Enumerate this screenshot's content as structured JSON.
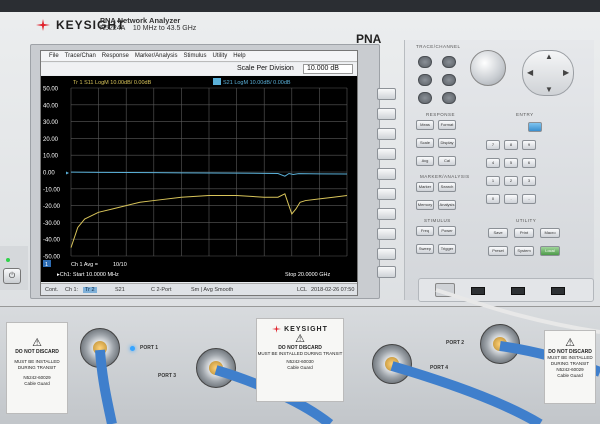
{
  "instrument": {
    "brand": "KEYSIGHT",
    "product_title": "PNA Network Analyzer",
    "model_number": "N5224A",
    "model_freq": "10 MHz to 43.5 GHz",
    "badge": "PNA"
  },
  "menu": [
    "File",
    "Trace/Chan",
    "Response",
    "Marker/Analysis",
    "Stimulus",
    "Utility",
    "Help"
  ],
  "scale": {
    "label": "Scale Per Division",
    "value": "10.000 dB"
  },
  "traces": {
    "tr1_label": "Tr 1  S11 LogM 10.00dB/  0.00dB",
    "tr2_label": "S21 LogM 10.00dB/  0.00dB",
    "y_ticks": [
      "50.00",
      "40.00",
      "30.00",
      "20.00",
      "10.00",
      "0.00",
      "-10.00",
      "-20.00",
      "-30.00",
      "-40.00",
      "-50.00"
    ],
    "ref_marker": "▸",
    "colors": {
      "s11": "#d8c45a",
      "s21": "#5ab0d8",
      "grid": "#5a5a5a",
      "axis_text": "#ffffff"
    }
  },
  "chart_data": {
    "type": "line",
    "x_unit": "GHz",
    "xlim": [
      0.01,
      20.0
    ],
    "ylim": [
      -50,
      50
    ],
    "ylabel": "",
    "xlabel": "",
    "series": [
      {
        "name": "S11",
        "x": [
          0.01,
          0.5,
          1,
          2,
          3,
          4,
          5,
          6,
          8,
          10,
          12,
          14,
          15,
          15.5,
          16,
          16.3,
          16.6,
          17,
          18,
          19,
          20
        ],
        "values": [
          -45,
          -33,
          -28,
          -24,
          -22,
          -20,
          -18,
          -17,
          -15,
          -14,
          -14,
          -15,
          -15,
          -13,
          -25,
          -22,
          -18,
          -17,
          -16,
          -15,
          -14
        ]
      },
      {
        "name": "S21",
        "x": [
          0.01,
          2,
          4,
          6,
          8,
          10,
          12,
          14,
          15,
          15.5,
          15.8,
          16.1,
          16.5,
          18,
          20
        ],
        "values": [
          -0.1,
          -0.2,
          -0.3,
          -0.4,
          -0.5,
          -0.6,
          -0.7,
          -0.8,
          -0.9,
          -2.5,
          -0.9,
          -1.5,
          -1.0,
          -1.1,
          -1.2
        ]
      }
    ]
  },
  "plot_footer": {
    "ch_label": "Ch 1  Avg =",
    "avg": "10/10",
    "start": "▸Ch1: Start  10.0000 MHz",
    "stop": "Stop  20.0000 GHz",
    "channel_num": "1"
  },
  "status": {
    "cont": "Cont.",
    "ch": "Ch 1:",
    "tr": "Tr 2",
    "param": "S21",
    "port": "C  2-Port",
    "mode": "Sm | Avg Smooth",
    "lcl": "LCL",
    "time": "2018-02-26 07:50"
  },
  "panel": {
    "trace_channel": "TRACE/CHANNEL",
    "response": "RESPONSE",
    "entry": "ENTRY",
    "marker_analysis": "MARKER/ANALYSIS",
    "stimulus": "STIMULUS",
    "utility": "UTILITY",
    "response_keys": [
      "Meas",
      "Format",
      "Scale",
      "Display",
      "Avg",
      "Cal"
    ],
    "marker_keys": [
      "Marker",
      "Search",
      "Memory",
      "Analysis"
    ],
    "stimulus_keys": [
      "Freq",
      "Power",
      "Sweep",
      "Trigger"
    ],
    "utility_keys": [
      "Save",
      "Print",
      "Macro",
      "Preset",
      "System",
      "Local"
    ],
    "entry_keys": [
      "7",
      "8",
      "9",
      "4",
      "5",
      "6",
      "1",
      "2",
      "3",
      "0",
      ".",
      "-"
    ]
  },
  "ports": {
    "port1": "PORT 1",
    "port2": "PORT 2",
    "port3": "PORT 3",
    "port4": "PORT 4"
  },
  "guard_tag": {
    "warn": "⚠",
    "line1": "DO NOT DISCARD",
    "line2": "MUST BE INSTALLED DURING TRANSIT",
    "part": "N5242-60029",
    "part2": "N5242-60030",
    "desc": "Cable Guard"
  }
}
